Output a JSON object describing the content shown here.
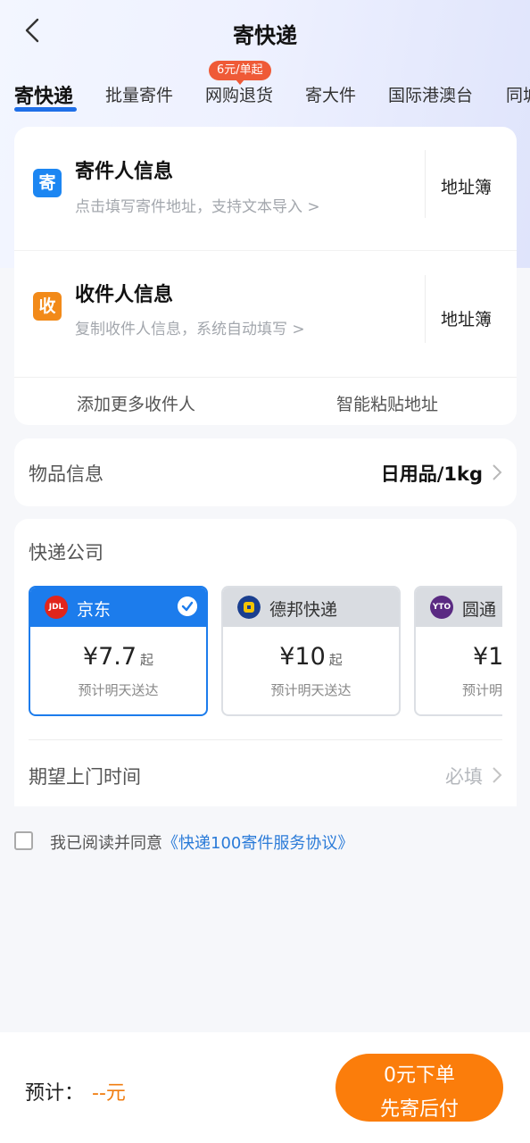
{
  "header": {
    "title": "寄快递"
  },
  "tabs": [
    {
      "label": "寄快递"
    },
    {
      "label": "批量寄件"
    },
    {
      "label": "网购退货"
    },
    {
      "label": "寄大件"
    },
    {
      "label": "国际港澳台"
    },
    {
      "label": "同城"
    }
  ],
  "tab_badge": "6元/单起",
  "sender": {
    "icon_char": "寄",
    "title": "寄件人信息",
    "hint": "点击填写寄件地址，支持文本导入 >",
    "book": "地址簿"
  },
  "receiver": {
    "icon_char": "收",
    "title": "收件人信息",
    "hint": "复制收件人信息，系统自动填写 >",
    "book": "地址簿"
  },
  "address_actions": {
    "add_more": "添加更多收件人",
    "smart_paste": "智能粘贴地址"
  },
  "goods": {
    "label": "物品信息",
    "value": "日用品/1kg"
  },
  "courier": {
    "label": "快递公司",
    "options": [
      {
        "name": "京东",
        "price": "¥7.7",
        "suffix": "起",
        "eta": "预计明天送达",
        "selected": true,
        "logo_color": "#e1251b",
        "logo_text": "JDL"
      },
      {
        "name": "德邦快递",
        "price": "¥10",
        "suffix": "起",
        "eta": "预计明天送达",
        "selected": false,
        "logo_color": "#1a3f8f",
        "logo_text": ""
      },
      {
        "name": "圆通",
        "price": "¥1",
        "suffix": "",
        "eta": "预计明",
        "selected": false,
        "logo_color": "#5a2a82",
        "logo_text": "YTO"
      }
    ]
  },
  "pickup": {
    "label": "期望上门时间",
    "value": "必填"
  },
  "agreement": {
    "text": "我已阅读并同意",
    "link": "《快递100寄件服务协议》"
  },
  "footer": {
    "estimate_label": "预计：",
    "estimate_value": "--元",
    "order_line1": "0元下单",
    "order_line2": "先寄后付"
  },
  "colors": {
    "accent": "#1c7cec",
    "order": "#fb7d0b",
    "badge": "#ef5a37"
  }
}
